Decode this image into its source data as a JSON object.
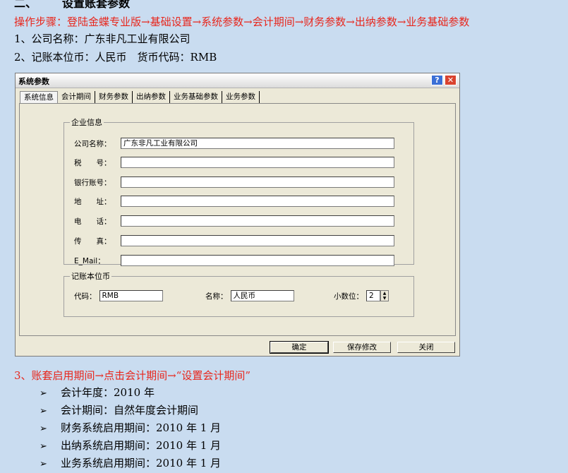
{
  "doc": {
    "heading_num": "二、",
    "heading_text": "设置账套参数",
    "steps": "操作步骤：登陆金蝶专业版→基础设置→系统参数→会计期间→财务参数→出纳参数→业务基础参数",
    "info1": "1、公司名称：广东非凡工业有限公司",
    "info2": "2、记账本位币：人民币　货币代码：RMB",
    "section3": "3、账套启用期间→点击会计期间→“设置会计期间”",
    "bullets": [
      "会计年度：2010 年",
      "会计期间：自然年度会计期间",
      "财务系统启用期间：2010 年 1 月",
      "出纳系统启用期间：2010 年 1 月",
      "业务系统启用期间：2010 年 1 月"
    ]
  },
  "dialog": {
    "title": "系统参数",
    "help": "?",
    "close": "✕",
    "tabs": [
      "系统信息",
      "会计期间",
      "财务参数",
      "出纳参数",
      "业务基础参数",
      "业务参数"
    ],
    "company_group": "企业信息",
    "fields": [
      {
        "label": "公司名称：",
        "value": "广东非凡工业有限公司"
      },
      {
        "label": "税　　号：",
        "value": ""
      },
      {
        "label": "银行账号：",
        "value": ""
      },
      {
        "label": "地　　址：",
        "value": ""
      },
      {
        "label": "电　　话：",
        "value": ""
      },
      {
        "label": "传　　真：",
        "value": ""
      },
      {
        "label": "E_Mail：",
        "value": ""
      }
    ],
    "currency_group": "记账本位币",
    "currency_code_label": "代码：",
    "currency_code": "RMB",
    "currency_name_label": "名称：",
    "currency_name": "人民币",
    "decimals_label": "小数位：",
    "decimals": "2",
    "buttons": {
      "ok": "确定",
      "save": "保存修改",
      "close": "关闭"
    }
  }
}
